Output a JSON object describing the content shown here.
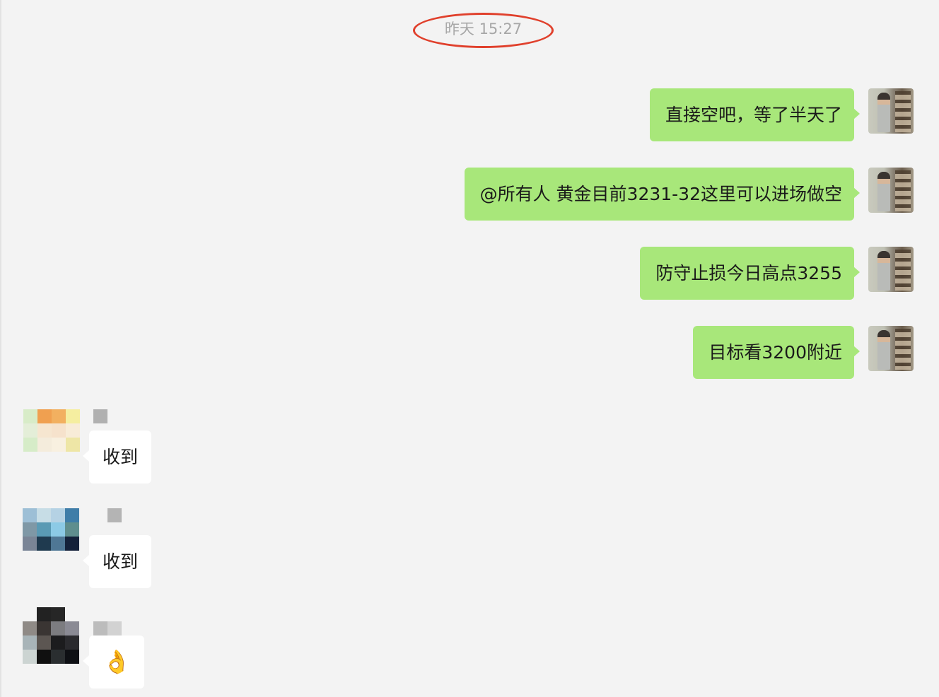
{
  "chat": {
    "timestamp": "昨天 15:27",
    "outgoing": [
      "直接空吧，等了半天了",
      "@所有人 黄金目前3231-32这里可以进场做空",
      "防守止损今日高点3255",
      "目标看3200附近"
    ],
    "incoming": [
      {
        "text": "收到"
      },
      {
        "text": "收到"
      },
      {
        "text": "👌"
      }
    ]
  },
  "icons": {
    "self_avatar": "user-photo-avatar",
    "member_avatar": "pixelated-avatar",
    "member_name": "pixelated-name"
  },
  "colors": {
    "background": "#f3f3f3",
    "outgoing_bubble": "#a8e77a",
    "incoming_bubble": "#ffffff",
    "timestamp_text": "#a7a7a7",
    "highlight_ring": "#e0402c"
  }
}
